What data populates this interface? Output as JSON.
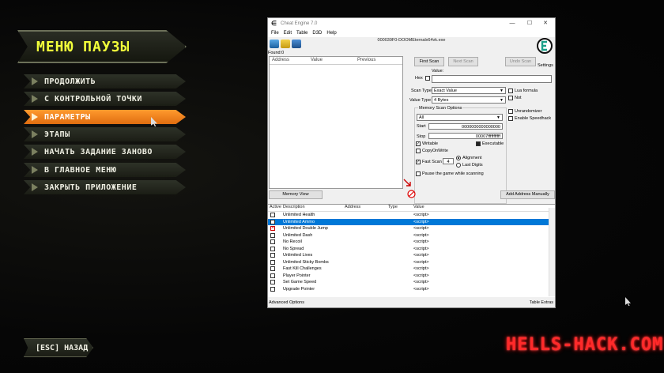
{
  "game": {
    "title": "МЕНЮ ПАУЗЫ",
    "menu": [
      {
        "label": "ПРОДОЛЖИТЬ",
        "active": false
      },
      {
        "label": "С КОНТРОЛЬНОЙ ТОЧКИ",
        "active": false
      },
      {
        "label": "ПАРАМЕТРЫ",
        "active": true
      },
      {
        "label": "ЭТАПЫ",
        "active": false
      },
      {
        "label": "НАЧАТЬ ЗАДАНИЕ ЗАНОВО",
        "active": false
      },
      {
        "label": "В ГЛАВНОЕ МЕНЮ",
        "active": false
      },
      {
        "label": "ЗАКРЫТЬ ПРИЛОЖЕНИЕ",
        "active": false
      }
    ],
    "back_button": "[ESC] НАЗАД",
    "watermark": "HELLS-HACK.COM",
    "accent_color": "#f1ff3a",
    "active_color": "#ff8c1a"
  },
  "ce": {
    "window_title": "Cheat Engine 7.0",
    "menu": [
      "File",
      "Edit",
      "Table",
      "D3D",
      "Help"
    ],
    "process": "000039F0-DOOMEternalx64vk.exe",
    "found": "Found:0",
    "list_headers": {
      "address": "Address",
      "value": "Value",
      "previous": "Previous"
    },
    "buttons": {
      "first_scan": "First Scan",
      "next_scan": "Next Scan",
      "undo_scan": "Undo Scan",
      "memory_view": "Memory View",
      "add_address": "Add Address Manually",
      "settings": "Settings"
    },
    "value_label": "Value:",
    "hex_label": "Hex",
    "scan_type_label": "Scan Type",
    "scan_type": "Exact Value",
    "value_type_label": "Value Type",
    "value_type": "4 Bytes",
    "lua_formula": "Lua formula",
    "not_label": "Not",
    "memory_scan_options": "Memory Scan Options",
    "region": "All",
    "start_label": "Start",
    "start_value": "0000000000000000",
    "stop_label": "Stop",
    "stop_value": "00007fffffffffff",
    "writable": "Writable",
    "executable": "Executable",
    "copy_on_write": "CopyOnWrite",
    "fast_scan": "Fast Scan",
    "fast_scan_value": "4",
    "alignment": "Alignment",
    "last_digits": "Last Digits",
    "pause_game": "Pause the game while scanning",
    "unrandomizer": "Unrandomizer",
    "speedhack": "Enable Speedhack",
    "table_headers": {
      "active": "Active",
      "description": "Description",
      "address": "Address",
      "type": "Type",
      "value": "Value"
    },
    "table_rows": [
      {
        "description": "Unlimited Health",
        "value": "<script>",
        "selected": false,
        "checked": false
      },
      {
        "description": "Unlimited Ammo",
        "value": "<script>",
        "selected": true,
        "checked": false
      },
      {
        "description": "Unlimited Double Jump",
        "value": "<script>",
        "selected": false,
        "checked": true
      },
      {
        "description": "Unlimited Dash",
        "value": "<script>",
        "selected": false,
        "checked": false
      },
      {
        "description": "No Recoil",
        "value": "<script>",
        "selected": false,
        "checked": false
      },
      {
        "description": "No Spread",
        "value": "<script>",
        "selected": false,
        "checked": false
      },
      {
        "description": "Unlimited Lives",
        "value": "<script>",
        "selected": false,
        "checked": false
      },
      {
        "description": "Unlimited Sticky Bombs",
        "value": "<script>",
        "selected": false,
        "checked": false
      },
      {
        "description": "Fast Kill Challenges",
        "value": "<script>",
        "selected": false,
        "checked": false
      },
      {
        "description": "Player Pointer",
        "value": "<script>",
        "selected": false,
        "checked": false
      },
      {
        "description": "Set Game Speed",
        "value": "<script>",
        "selected": false,
        "checked": false
      },
      {
        "description": "Upgrade Pointer",
        "value": "<script>",
        "selected": false,
        "checked": false
      }
    ],
    "advanced_options": "Advanced Options",
    "table_extras": "Table Extras"
  }
}
